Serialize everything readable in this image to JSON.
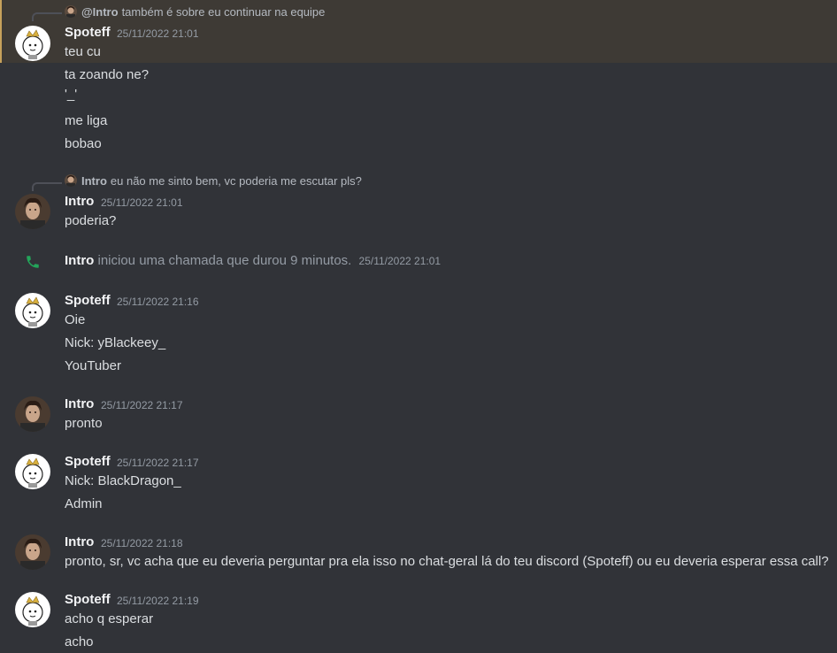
{
  "colors": {
    "background": "#313338",
    "highlight": "#3e3a35",
    "highlight_bar": "#c6a15b",
    "call_icon": "#23a55a"
  },
  "groups": [
    {
      "reply": {
        "name": "@Intro",
        "text": "também é sobre eu continuar na equipe"
      },
      "author": "Spoteff",
      "timestamp": "25/11/2022 21:01",
      "lines": [
        "teu cu",
        "ta zoando ne?",
        "'_'",
        "me liga",
        "bobao"
      ]
    },
    {
      "reply": {
        "name": "Intro",
        "text": "eu não me sinto bem, vc poderia me escutar pls?"
      },
      "author": "Intro",
      "timestamp": "25/11/2022 21:01",
      "lines": [
        "poderia?"
      ]
    },
    {
      "system": {
        "name": "Intro",
        "text": "iniciou uma chamada que durou 9 minutos.",
        "timestamp": "25/11/2022 21:01",
        "icon": "phone-icon"
      }
    },
    {
      "author": "Spoteff",
      "timestamp": "25/11/2022 21:16",
      "lines": [
        "Oie",
        "Nick: yBlackeey_",
        "YouTuber"
      ]
    },
    {
      "author": "Intro",
      "timestamp": "25/11/2022 21:17",
      "lines": [
        "pronto"
      ]
    },
    {
      "author": "Spoteff",
      "timestamp": "25/11/2022 21:17",
      "lines": [
        "Nick: BlackDragon_",
        "Admin"
      ]
    },
    {
      "author": "Intro",
      "timestamp": "25/11/2022 21:18",
      "lines": [
        "pronto, sr, vc acha que eu deveria perguntar pra ela isso no chat-geral lá do teu discord (Spoteff) ou eu deveria esperar essa call?"
      ]
    },
    {
      "author": "Spoteff",
      "timestamp": "25/11/2022 21:19",
      "lines": [
        "acho q esperar",
        "acho"
      ]
    }
  ]
}
